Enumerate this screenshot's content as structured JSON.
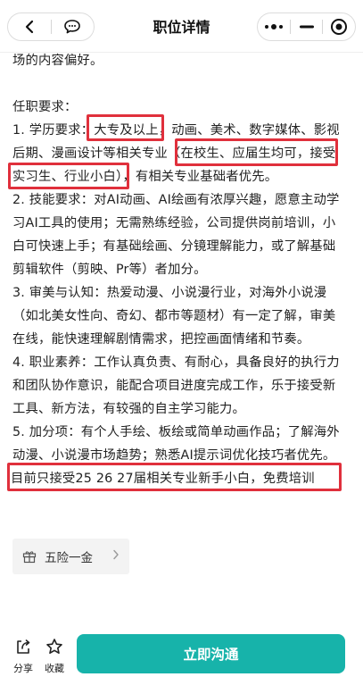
{
  "nav": {
    "title": "职位详情"
  },
  "lines": [
    "场的内容偏好。",
    "任职要求：",
    "1. 学历要求：大专及以上，动画、美术、数字媒体、影视",
    "后期、漫画设计等相关专业（在校生、应届生均可，接受",
    "实习生、行业小白），有相关专业基础者优先。",
    "2. 技能要求：对AI动画、AI绘画有浓厚兴趣，愿意主动学",
    "习AI工具的使用；无需熟练经验，公司提供岗前培训，小",
    "白可快速上手；有基础绘画、分镜理解能力，或了解基础",
    "剪辑软件（剪映、Pr等）者加分。",
    "3. 审美与认知：热爱动漫、小说漫行业，对海外小说漫",
    "（如北美女性向、奇幻、都市等题材）有一定了解，审美",
    "在线，能快速理解剧情需求，把控画面情绪和节奏。",
    "4. 职业素养：工作认真负责、有耐心，具备良好的执行力",
    "和团队协作意识，能配合项目进度完成工作，乐于接受新",
    "工具、新方法，有较强的自主学习能力。",
    "5. 加分项：有个人手绘、板绘或简单动画作品；了解海外",
    "动漫、小说漫市场趋势；熟悉AI提示词优化技巧者优先。",
    "目前只接受25 26 27届相关专业新手小白，免费培训"
  ],
  "benefit": {
    "label": "五险一金"
  },
  "bottom": {
    "share_label": "分享",
    "favorite_label": "收藏",
    "cta_label": "立即沟通"
  },
  "colors": {
    "accent": "#17b3aa",
    "highlight": "#e0303c"
  }
}
